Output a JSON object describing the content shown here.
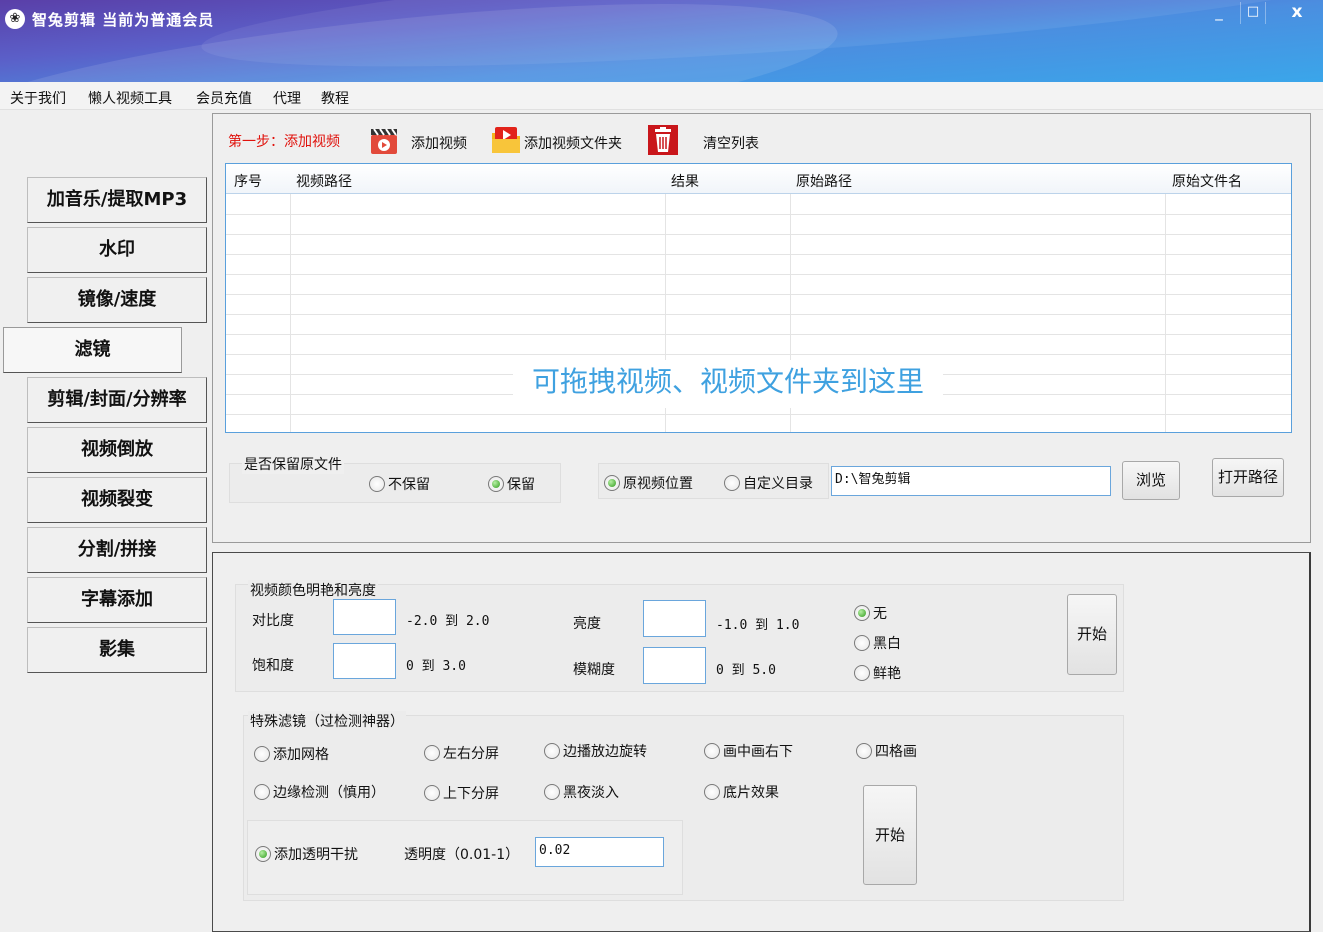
{
  "window": {
    "title": "智兔剪辑  当前为普通会员",
    "minimize_label": "_",
    "maximize_label": "□",
    "close_label": "x"
  },
  "menu": {
    "items": [
      "关于我们",
      "懒人视频工具",
      "会员充值",
      "代理",
      "教程"
    ]
  },
  "sidebar": {
    "items": [
      {
        "label": "加音乐/提取MP3",
        "active": false
      },
      {
        "label": "水印",
        "active": false
      },
      {
        "label": "镜像/速度",
        "active": false
      },
      {
        "label": "滤镜",
        "active": true
      },
      {
        "label": "剪辑/封面/分辨率",
        "active": false
      },
      {
        "label": "视频倒放",
        "active": false
      },
      {
        "label": "视频裂变",
        "active": false
      },
      {
        "label": "分割/拼接",
        "active": false
      },
      {
        "label": "字幕添加",
        "active": false
      },
      {
        "label": "影集",
        "active": false
      }
    ]
  },
  "toolbar": {
    "step_label": "第一步：添加视频",
    "add_video_label": "添加视频",
    "add_folder_label": "添加视频文件夹",
    "clear_list_label": "清空列表"
  },
  "video_list": {
    "columns": [
      "序号",
      "视频路径",
      "结果",
      "原始路径",
      "原始文件名"
    ],
    "rows": [],
    "drop_hint": "可拖拽视频、视频文件夹到这里"
  },
  "keep_original": {
    "title": "是否保留原文件",
    "option_no": "不保留",
    "option_yes": "保留",
    "selected": "保留"
  },
  "output": {
    "option_original_location": "原视频位置",
    "option_custom_dir": "自定义目录",
    "selected": "原视频位置",
    "path_value": "D:\\智兔剪辑",
    "browse_label": "浏览",
    "open_path_label": "打开路径"
  },
  "color_section": {
    "title": "视频颜色明艳和亮度",
    "contrast_label": "对比度",
    "contrast_value": "",
    "contrast_range": "-2.0 到 2.0",
    "saturation_label": "饱和度",
    "saturation_value": "",
    "saturation_range": "0 到 3.0",
    "brightness_label": "亮度",
    "brightness_value": "",
    "brightness_range": "-1.0 到 1.0",
    "blur_label": "模糊度",
    "blur_value": "",
    "blur_range": "0 到 5.0",
    "mode_none": "无",
    "mode_bw": "黑白",
    "mode_vivid": "鲜艳",
    "mode_selected": "无",
    "start_label": "开始"
  },
  "special_filter": {
    "title": "特殊滤镜（过检测神器）",
    "options": {
      "grid": "添加网格",
      "split_lr": "左右分屏",
      "zoom_rotate": "边播放边旋转",
      "pip": "画中画右下",
      "four_grid": "四格画",
      "edge_detect": "边缘检测（慎用）",
      "split_tb": "上下分屏",
      "night_fade": "黑夜淡入",
      "negative": "底片效果"
    },
    "transparent_label": "添加透明干扰",
    "transparent_checked": true,
    "opacity_label": "透明度（0.01-1）",
    "opacity_value": "0.02",
    "start_label": "开始"
  },
  "colors": {
    "accent_red": "#e0120c",
    "hint_blue": "#3fa1e0",
    "list_border": "#5aa0dc",
    "radio_green": "#2f9b1c"
  }
}
